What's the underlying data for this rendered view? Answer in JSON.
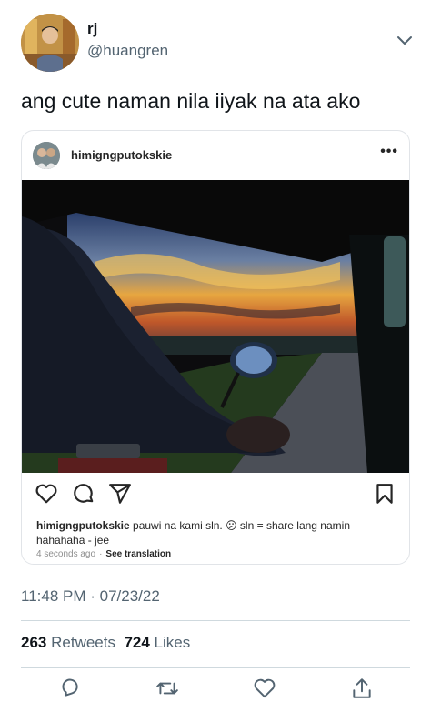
{
  "tweet": {
    "display_name": "rj",
    "handle": "@huangren",
    "text": "ang cute naman nila iiyak na ata ako",
    "timestamp": "11:48 PM · 07/23/22",
    "retweets_count": "263",
    "retweets_label": "Retweets",
    "likes_count": "724",
    "likes_label": "Likes"
  },
  "instagram_embed": {
    "username": "himigngputokskie",
    "more_label": "•••",
    "caption_user": "himigngputokskie",
    "caption_text": "pauwi na kami sln. 😕 sln = share lang namin hahahaha - jee",
    "time_ago": "4 seconds ago",
    "separator": "·",
    "translate_label": "See translation"
  },
  "icons": {
    "header": [
      "avatar",
      "chevron-down-icon"
    ],
    "instagram": [
      "heart-icon",
      "comment-icon",
      "share-icon",
      "bookmark-icon"
    ],
    "tweet_actions": [
      "reply-icon",
      "retweet-icon",
      "like-icon",
      "share-icon"
    ]
  },
  "colors": {
    "text_primary": "#0f1419",
    "text_secondary": "#536471",
    "divider": "#cfd9de",
    "card_border": "#e1e4e8"
  }
}
